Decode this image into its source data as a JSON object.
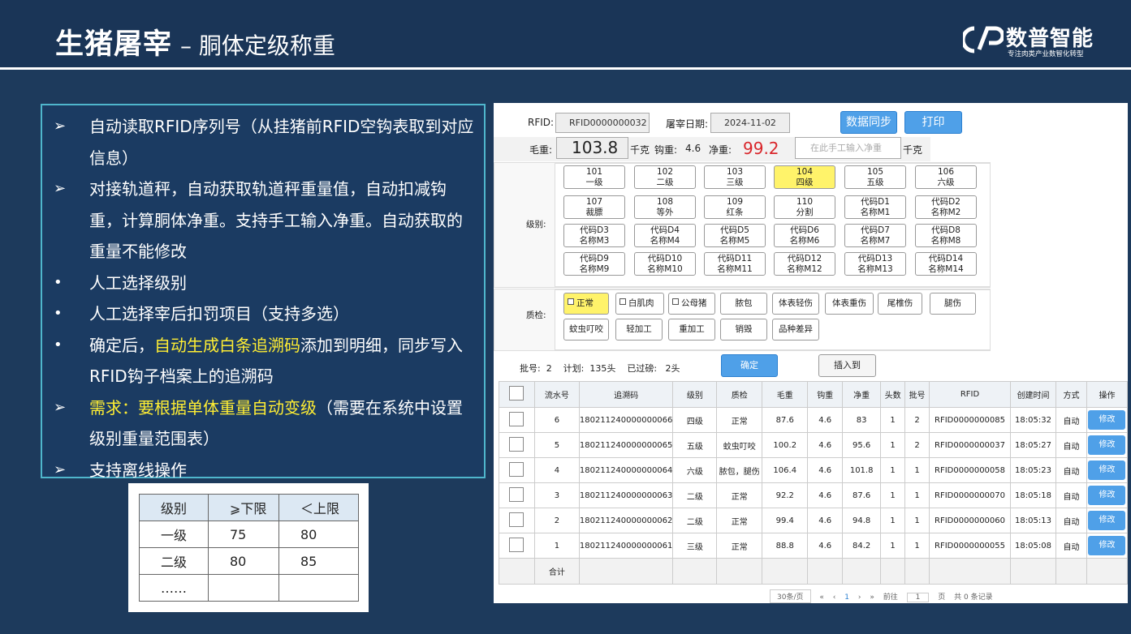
{
  "header": {
    "title_main": "生猪屠宰",
    "title_sub": "– 胴体定级称重"
  },
  "logo": {
    "name": "数普智能",
    "tagline": "专注肉类产业数智化转型"
  },
  "bullets": [
    {
      "marker": "➢",
      "pre": "自动读取RFID序列号（从挂猪前RFID空钩表取到对应信息）",
      "hl": "",
      "post": ""
    },
    {
      "marker": "➢",
      "pre": "对接轨道秤，自动获取轨道秤重量值，自动扣减钩重，计算胴体净重。支持手工输入净重。自动获取的重量不能修改",
      "hl": "",
      "post": ""
    },
    {
      "marker": "•",
      "pre": "人工选择级别",
      "hl": "",
      "post": ""
    },
    {
      "marker": "•",
      "pre": "人工选择宰后扣罚项目（支持多选）",
      "hl": "",
      "post": ""
    },
    {
      "marker": "•",
      "pre": "确定后，",
      "hl": "自动生成白条追溯码",
      "post": "添加到明细，同步写入RFID钩子档案上的追溯码"
    },
    {
      "marker": "➢",
      "pre": "",
      "hl": "需求：要根据单体重量自动变级",
      "post": "（需要在系统中设置级别重量范围表）"
    },
    {
      "marker": "➢",
      "pre": "支持离线操作",
      "hl": "",
      "post": ""
    }
  ],
  "grade_table": {
    "headers": [
      "级别",
      "⩾下限",
      "＜上限"
    ],
    "rows": [
      [
        "一级",
        "75",
        "80"
      ],
      [
        "二级",
        "80",
        "85"
      ],
      [
        "……",
        "",
        ""
      ]
    ]
  },
  "app": {
    "rfid_label": "RFID:",
    "rfid_value": "RFID0000000032",
    "date_label": "屠宰日期:",
    "date_value": "2024-11-02",
    "sync_btn": "数据同步",
    "print_btn": "打印",
    "gross_label": "毛重:",
    "gross_value": "103.8",
    "unit_kg": "千克",
    "hook_label": "钩重:",
    "hook_value": "4.6",
    "net_label": "净重:",
    "net_value": "99.2",
    "net_placeholder": "在此手工输入净重",
    "unit_kg2": "千克",
    "grade_label": "级别:",
    "grades": [
      {
        "code": "101",
        "name": "一级"
      },
      {
        "code": "102",
        "name": "二级"
      },
      {
        "code": "103",
        "name": "三级"
      },
      {
        "code": "104",
        "name": "四级"
      },
      {
        "code": "105",
        "name": "五级"
      },
      {
        "code": "106",
        "name": "六级"
      },
      {
        "code": "107",
        "name": "裁膘"
      },
      {
        "code": "108",
        "name": "等外"
      },
      {
        "code": "109",
        "name": "红条"
      },
      {
        "code": "110",
        "name": "分割"
      },
      {
        "code": "代码D1",
        "name": "名称M1"
      },
      {
        "code": "代码D2",
        "name": "名称M2"
      },
      {
        "code": "代码D3",
        "name": "名称M3"
      },
      {
        "code": "代码D4",
        "name": "名称M4"
      },
      {
        "code": "代码D5",
        "name": "名称M5"
      },
      {
        "code": "代码D6",
        "name": "名称M6"
      },
      {
        "code": "代码D7",
        "name": "名称M7"
      },
      {
        "code": "代码D8",
        "name": "名称M8"
      },
      {
        "code": "代码D9",
        "name": "名称M9"
      },
      {
        "code": "代码D10",
        "name": "名称M10"
      },
      {
        "code": "代码D11",
        "name": "名称M11"
      },
      {
        "code": "代码D12",
        "name": "名称M12"
      },
      {
        "code": "代码D13",
        "name": "名称M13"
      },
      {
        "code": "代码D14",
        "name": "名称M14"
      }
    ],
    "grade_selected": "104",
    "qc_label": "质检:",
    "qc_items": [
      "正常",
      "白肌肉",
      "公母猪",
      "脓包",
      "体表轻伤",
      "体表重伤",
      "尾椎伤",
      "腿伤",
      "蚊虫叮咬",
      "轻加工",
      "重加工",
      "销毁",
      "品种差异"
    ],
    "qc_selected": "正常",
    "batch_text": "批号:  2    计划:  135头    已过磅:   2头",
    "confirm_btn": "确定",
    "insert_btn": "插入到",
    "columns": [
      "",
      "流水号",
      "追溯码",
      "级别",
      "质检",
      "毛重",
      "钩重",
      "净重",
      "头数",
      "批号",
      "RFID",
      "创建时间",
      "方式",
      "操作"
    ],
    "rows": [
      [
        "6",
        "180211240000000066",
        "四级",
        "正常",
        "87.6",
        "4.6",
        "83",
        "1",
        "2",
        "RFID0000000085",
        "18:05:32",
        "自动"
      ],
      [
        "5",
        "180211240000000065",
        "五级",
        "蚊虫叮咬",
        "100.2",
        "4.6",
        "95.6",
        "1",
        "2",
        "RFID0000000037",
        "18:05:27",
        "自动"
      ],
      [
        "4",
        "180211240000000064",
        "六级",
        "脓包，腿伤",
        "106.4",
        "4.6",
        "101.8",
        "1",
        "1",
        "RFID0000000058",
        "18:05:23",
        "自动"
      ],
      [
        "3",
        "180211240000000063",
        "二级",
        "正常",
        "92.2",
        "4.6",
        "87.6",
        "1",
        "1",
        "RFID0000000070",
        "18:05:18",
        "自动"
      ],
      [
        "2",
        "180211240000000062",
        "二级",
        "正常",
        "99.4",
        "4.6",
        "94.8",
        "1",
        "1",
        "RFID0000000060",
        "18:05:13",
        "自动"
      ],
      [
        "1",
        "180211240000000061",
        "三级",
        "正常",
        "88.8",
        "4.6",
        "84.2",
        "1",
        "1",
        "RFID0000000055",
        "18:05:08",
        "自动"
      ]
    ],
    "edit_btn": "修改",
    "total_label": "合计",
    "pager": {
      "page_size": "30条/页",
      "first": "«",
      "prev": "‹",
      "current": "1",
      "next": "›",
      "last": "»",
      "goto_label": "前往",
      "goto_value": "1",
      "page_label": "页",
      "total": "共 0 条记录"
    }
  },
  "colors": {
    "bg": "#1d3a5c",
    "highlight": "#ffee33",
    "selected": "#fff36a",
    "button": "#4fa0e8",
    "net_weight": "#d9262b"
  }
}
